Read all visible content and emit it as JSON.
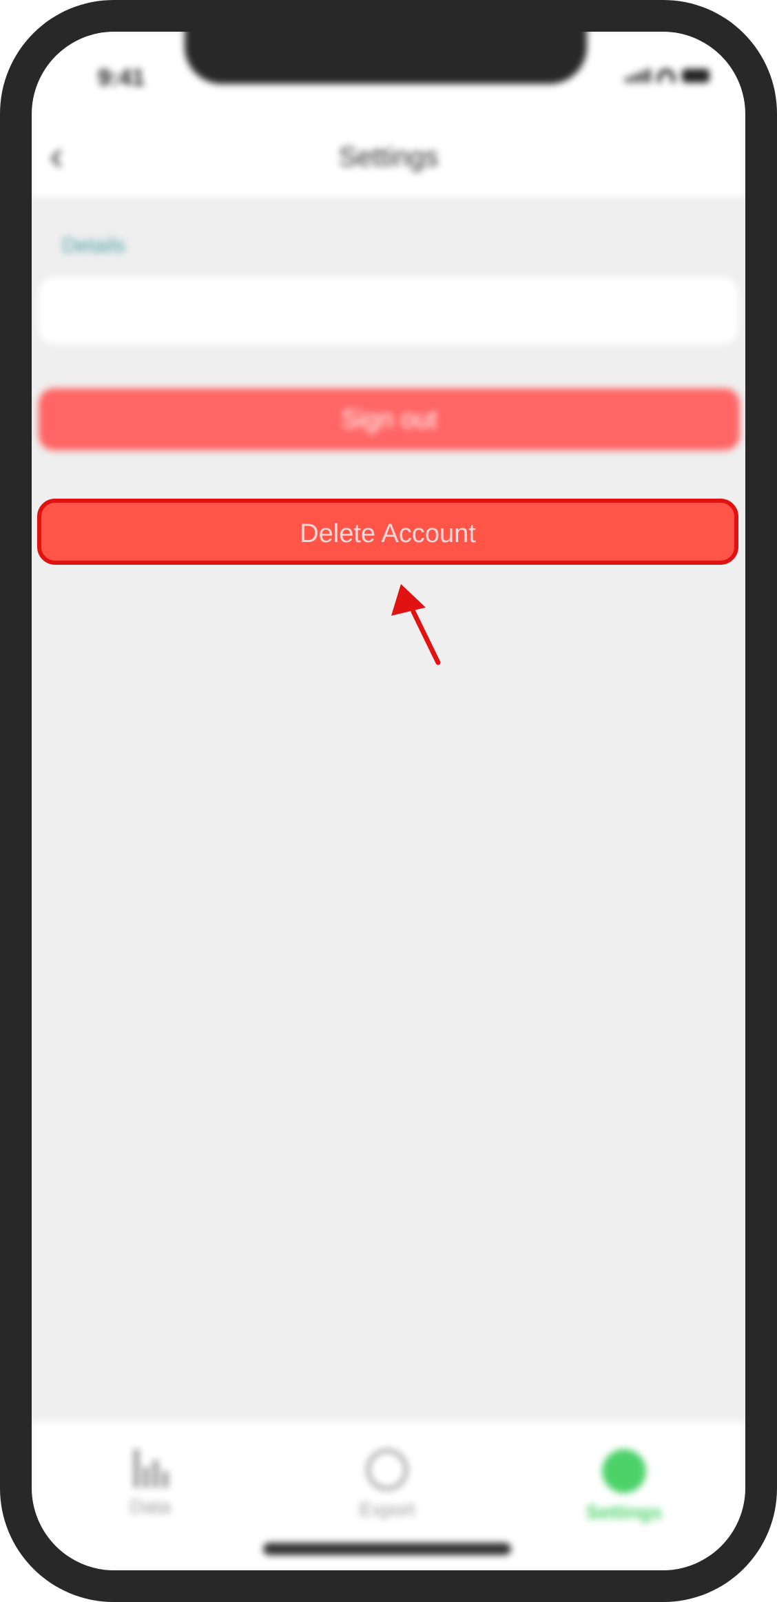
{
  "status_bar": {
    "time": "9:41",
    "icons": [
      "signal-icon",
      "wifi-icon",
      "battery-icon"
    ]
  },
  "nav": {
    "back_icon": "chevron-left-icon",
    "title": "Settings"
  },
  "section": {
    "label": "Details"
  },
  "buttons": {
    "sign_out": "Sign out",
    "delete_account": "Delete Account"
  },
  "tabs": [
    {
      "label": "Data",
      "icon": "bar-chart-icon",
      "active": false
    },
    {
      "label": "Export",
      "icon": "export-icon",
      "active": false
    },
    {
      "label": "Settings",
      "icon": "settings-icon",
      "active": true
    }
  ],
  "colors": {
    "sign_out_bg": "#ff6565",
    "delete_bg": "#ff5548",
    "highlight": "#e01212",
    "active_tab": "#4dd26a",
    "section_label": "#4b9ea4"
  }
}
